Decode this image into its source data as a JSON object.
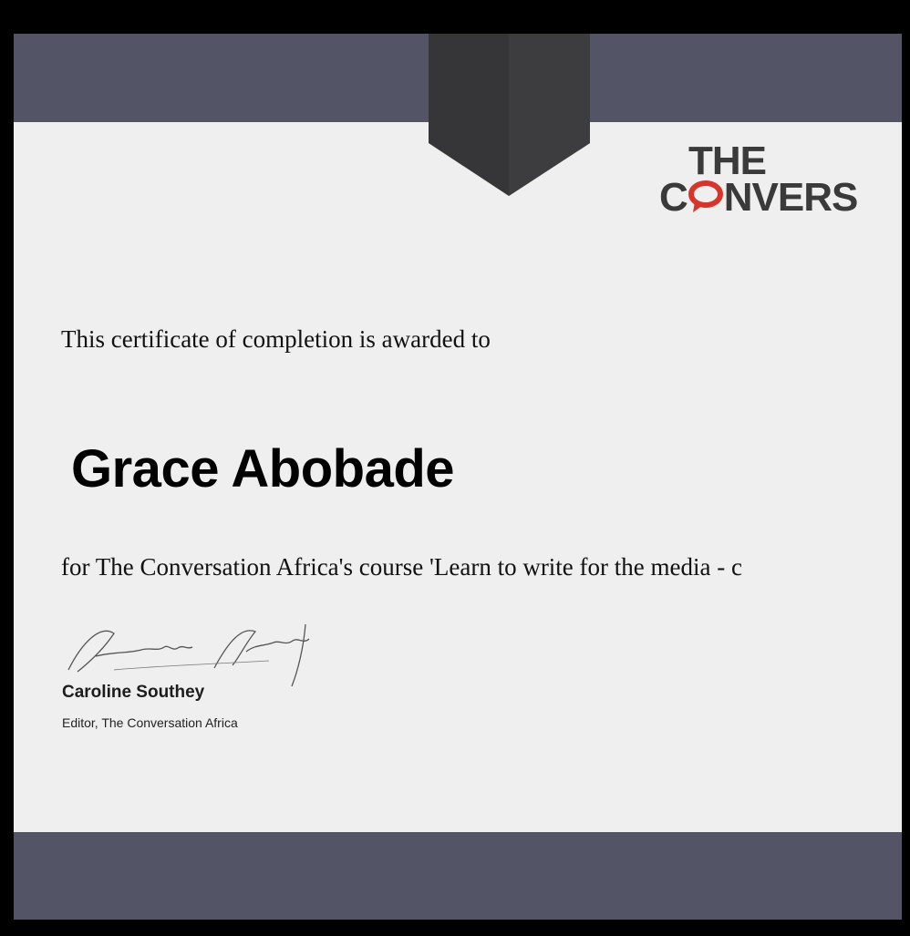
{
  "certificate": {
    "logo": {
      "line1": "THE",
      "line2_prefix": "C",
      "line2_rest": "NVERS",
      "icon": "speech-bubble-icon",
      "accent_color": "#d8352a"
    },
    "awarded_text": "This certificate of completion is awarded to",
    "recipient_name": "Grace Abobade",
    "course_text": "for The Conversation Africa's course 'Learn to write for the media - c",
    "signer": {
      "name": "Caroline Southey",
      "title": "Editor, The Conversation Africa"
    }
  },
  "colors": {
    "band": "#545467",
    "ribbon": "#363638",
    "paper": "#efefef",
    "frame": "#000000"
  }
}
